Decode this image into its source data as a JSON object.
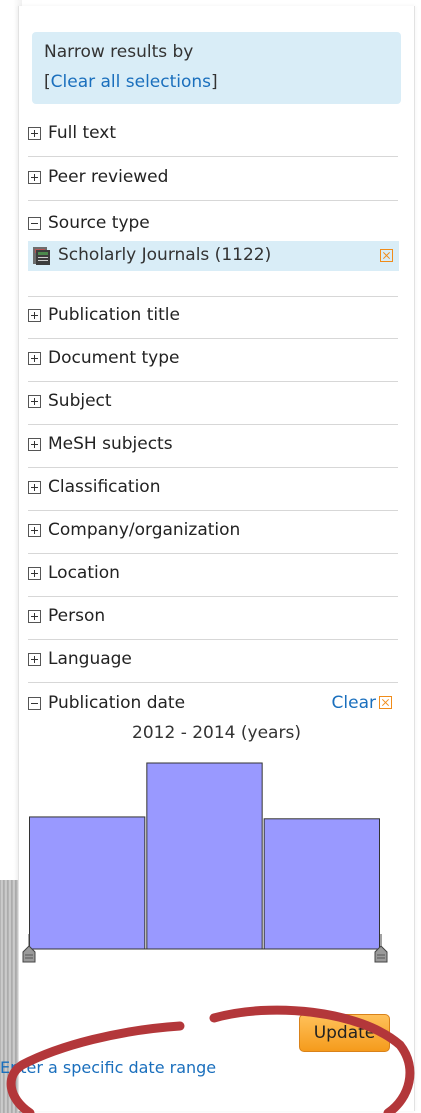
{
  "narrow": {
    "title": "Narrow results by",
    "bracket_open": "[",
    "clear_all": "Clear all selections",
    "bracket_close": "]"
  },
  "facets": {
    "full_text": "Full text",
    "peer_reviewed": "Peer reviewed",
    "source_type": "Source type",
    "source_selected": "Scholarly Journals (1122)",
    "items": [
      "Publication title",
      "Document type",
      "Subject",
      "MeSH subjects",
      "Classification",
      "Company/organization",
      "Location",
      "Person",
      "Language"
    ]
  },
  "pubdate": {
    "label": "Publication date",
    "clear": "Clear",
    "range": "2012 - 2014 (years)",
    "histogram": [
      0.71,
      1.0,
      0.7
    ],
    "update": "Update",
    "specific_range": "Enter a specific date range"
  },
  "colors": {
    "bar": "#9999ff",
    "panel_highlight": "#d9edf7",
    "link": "#1a6fbd",
    "update_button": "#f7a626",
    "annotation": "#b3373a"
  },
  "icons": {
    "expand": "plus-box-icon",
    "collapse": "minus-box-icon",
    "remove": "remove-x-icon",
    "journal": "journal-icon",
    "slider_handle": "slider-handle-icon"
  }
}
